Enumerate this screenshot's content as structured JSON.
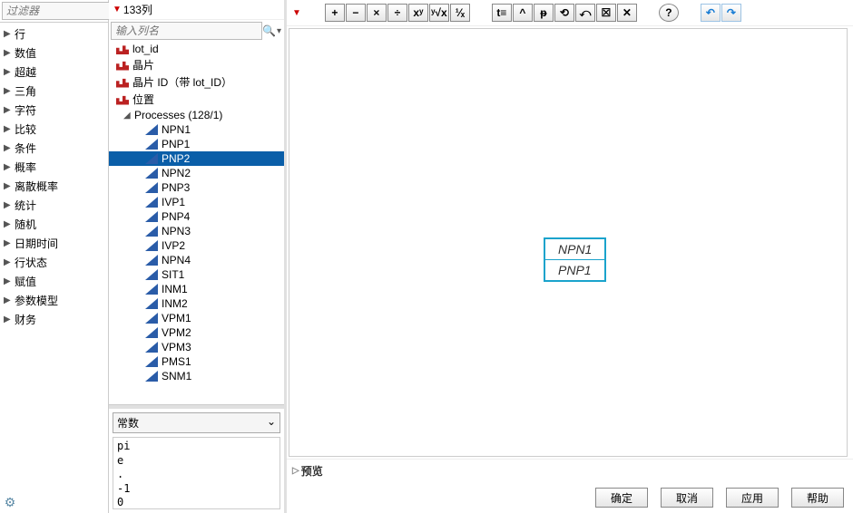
{
  "sidebar": {
    "filter_placeholder": "过滤器",
    "categories": [
      "行",
      "数值",
      "超越",
      "三角",
      "字符",
      "比较",
      "条件",
      "概率",
      "离散概率",
      "统计",
      "随机",
      "日期时间",
      "行状态",
      "赋值",
      "参数模型",
      "财务"
    ]
  },
  "columns": {
    "header": "133列",
    "search_placeholder": "输入列名",
    "top": [
      {
        "name": "lot_id",
        "type": "nom"
      },
      {
        "name": "晶片",
        "type": "nom"
      },
      {
        "name": "晶片 ID（带 lot_ID）",
        "type": "nom"
      },
      {
        "name": "位置",
        "type": "nom"
      }
    ],
    "group_label": "Processes (128/1)",
    "children": [
      "NPN1",
      "PNP1",
      "PNP2",
      "NPN2",
      "PNP3",
      "IVP1",
      "PNP4",
      "NPN3",
      "IVP2",
      "NPN4",
      "SIT1",
      "INM1",
      "INM2",
      "VPM1",
      "VPM2",
      "VPM3",
      "PMS1",
      "SNM1"
    ],
    "selected": "PNP2"
  },
  "constants": {
    "select_label": "常数",
    "items": [
      "pi",
      "e",
      ".",
      "-1",
      "0"
    ]
  },
  "toolbar": {
    "ops": [
      "+",
      "−",
      "×",
      "÷",
      "xʸ",
      "ʸ√x",
      "¹⁄ₓ"
    ],
    "edits": [
      "t≡",
      "^",
      "ᵽ",
      "⟲",
      "⤺",
      "☒",
      "✕"
    ],
    "help": "?",
    "undo": "↶",
    "redo": "↷"
  },
  "formula": {
    "stack": [
      "NPN1",
      "PNP1"
    ]
  },
  "preview_label": "预览",
  "buttons": {
    "ok": "确定",
    "cancel": "取消",
    "apply": "应用",
    "help": "帮助"
  }
}
